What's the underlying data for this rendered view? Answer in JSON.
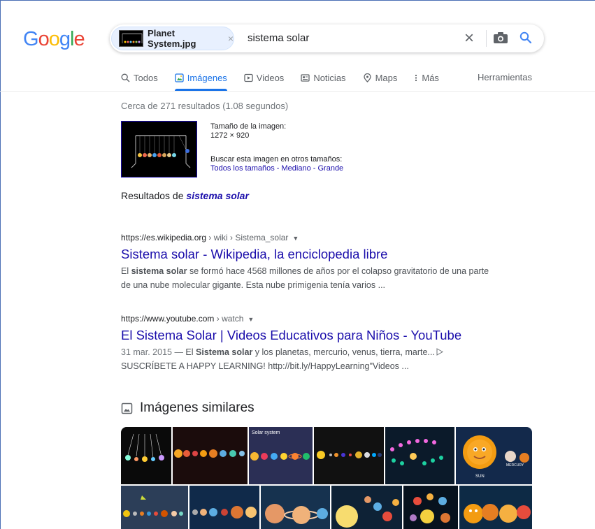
{
  "logo": {
    "letters": [
      "G",
      "o",
      "o",
      "g",
      "l",
      "e"
    ],
    "colors": [
      "#4285f4",
      "#ea4335",
      "#fbbc05",
      "#4285f4",
      "#34a853",
      "#ea4335"
    ]
  },
  "search": {
    "chip_label": "Planet System.jpg",
    "chip_close": "×",
    "query": "sistema solar",
    "clear": "×"
  },
  "tabs": [
    "Todos",
    "Imágenes",
    "Videos",
    "Noticias",
    "Maps",
    "Más"
  ],
  "active_tab": "Imágenes",
  "tools": "Herramientas",
  "stats": "Cerca de 271 resultados (1.08 segundos)",
  "image_info": {
    "size_label": "Tamaño de la imagen:",
    "size_value": "1272 × 920",
    "other_sizes_label": "Buscar esta imagen en otros tamaños:",
    "link_all": "Todos los tamaños",
    "sep": " - ",
    "link_medium": "Mediano",
    "link_large": "Grande"
  },
  "results_for": {
    "prefix": "Resultados de ",
    "term": "sistema solar"
  },
  "results": [
    {
      "domain": "https://es.wikipedia.org",
      "path": " › wiki › Sistema_solar",
      "title": "Sistema solar - Wikipedia, la enciclopedia libre",
      "snippet_1a": "El ",
      "snippet_1b": "sistema solar",
      "snippet_1c": " se formó hace 4568 millones de años por el colapso gravitatorio de una parte",
      "snippet_2": "de una nube molecular gigante. Esta nube primigenia tenía varios ..."
    },
    {
      "domain": "https://www.youtube.com",
      "path": " › watch",
      "title": "El Sistema Solar | Videos Educativos para Niños - YouTube",
      "date": "31 mar. 2015 — ",
      "snippet_1a": "El ",
      "snippet_1b": "Sistema solar",
      "snippet_1c": " y los planetas, mercurio, venus, tierra, marte...",
      "snippet_2": "SUSCRÍBETE A HAPPY LEARNING! http://bit.ly/HappyLearning\"Videos ..."
    }
  ],
  "similar_heading": "Imágenes similares",
  "tile_labels": {
    "solar_system": "Solar system",
    "mercury": "MERCURY",
    "sun": "SUN"
  },
  "colors": {
    "link": "#1a0dab",
    "accent": "#1a73e8"
  }
}
